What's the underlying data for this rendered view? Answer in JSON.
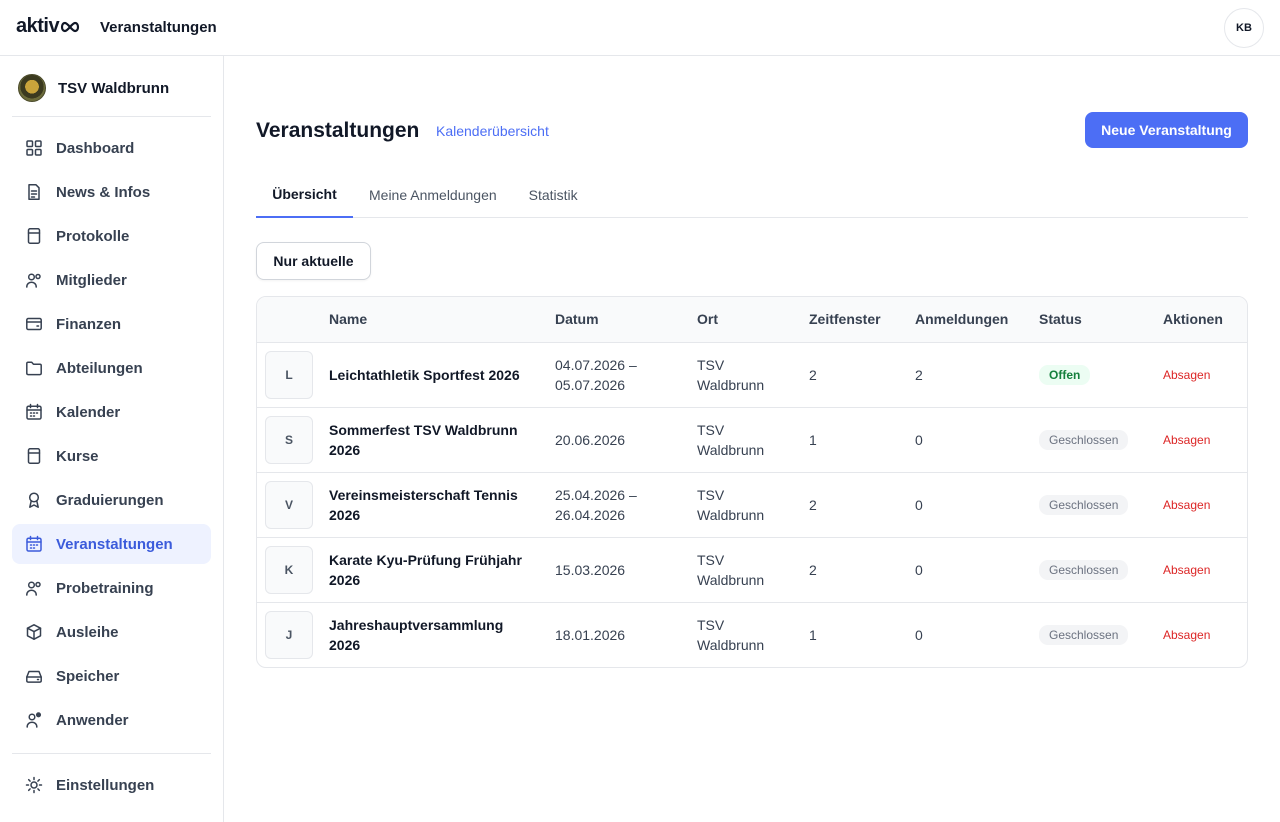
{
  "topbar": {
    "logo": "aktiv",
    "title": "Veranstaltungen",
    "avatar_initials": "KB"
  },
  "sidebar": {
    "club_name": "TSV Waldbrunn",
    "items": [
      {
        "label": "Dashboard",
        "icon": "grid-icon"
      },
      {
        "label": "News & Infos",
        "icon": "document-icon"
      },
      {
        "label": "Protokolle",
        "icon": "notebook-icon"
      },
      {
        "label": "Mitglieder",
        "icon": "users-icon"
      },
      {
        "label": "Finanzen",
        "icon": "wallet-icon"
      },
      {
        "label": "Abteilungen",
        "icon": "folder-icon"
      },
      {
        "label": "Kalender",
        "icon": "calendar-icon"
      },
      {
        "label": "Kurse",
        "icon": "notebook-icon"
      },
      {
        "label": "Graduierungen",
        "icon": "award-icon"
      },
      {
        "label": "Veranstaltungen",
        "icon": "calendar-icon"
      },
      {
        "label": "Probetraining",
        "icon": "users-icon"
      },
      {
        "label": "Ausleihe",
        "icon": "box-icon"
      },
      {
        "label": "Speicher",
        "icon": "drive-icon"
      },
      {
        "label": "Anwender",
        "icon": "user-plus-icon"
      }
    ],
    "active_index": 9,
    "settings_label": "Einstellungen"
  },
  "main": {
    "title": "Veranstaltungen",
    "calendar_link": "Kalenderübersicht",
    "new_button": "Neue Veranstaltung",
    "tabs": [
      "Übersicht",
      "Meine Anmeldungen",
      "Statistik"
    ],
    "active_tab": 0,
    "filter_button": "Nur aktuelle"
  },
  "table": {
    "columns": [
      "",
      "Name",
      "Datum",
      "Ort",
      "Zeitfenster",
      "Anmeldungen",
      "Status",
      "Aktionen"
    ],
    "rows": [
      {
        "initial": "L",
        "name": "Leichtathletik Sportfest 2026",
        "date": "04.07.2026 – 05.07.2026",
        "place": "TSV Waldbrunn",
        "slots": "2",
        "registrations": "2",
        "status": "Offen",
        "status_type": "open",
        "action": "Absagen"
      },
      {
        "initial": "S",
        "name": "Sommerfest TSV Waldbrunn 2026",
        "date": "20.06.2026",
        "place": "TSV Waldbrunn",
        "slots": "1",
        "registrations": "0",
        "status": "Geschlossen",
        "status_type": "closed",
        "action": "Absagen"
      },
      {
        "initial": "V",
        "name": "Vereinsmeisterschaft Tennis 2026",
        "date": "25.04.2026 – 26.04.2026",
        "place": "TSV Waldbrunn",
        "slots": "2",
        "registrations": "0",
        "status": "Geschlossen",
        "status_type": "closed",
        "action": "Absagen"
      },
      {
        "initial": "K",
        "name": "Karate Kyu-Prüfung Frühjahr 2026",
        "date": "15.03.2026",
        "place": "TSV Waldbrunn",
        "slots": "2",
        "registrations": "0",
        "status": "Geschlossen",
        "status_type": "closed",
        "action": "Absagen"
      },
      {
        "initial": "J",
        "name": "Jahreshauptversammlung 2026",
        "date": "18.01.2026",
        "place": "TSV Waldbrunn",
        "slots": "1",
        "registrations": "0",
        "status": "Geschlossen",
        "status_type": "closed",
        "action": "Absagen"
      }
    ]
  },
  "colors": {
    "accent": "#4c6ef5",
    "active_nav_bg": "#eef2ff",
    "danger": "#dc2626",
    "success": "#15803d"
  }
}
